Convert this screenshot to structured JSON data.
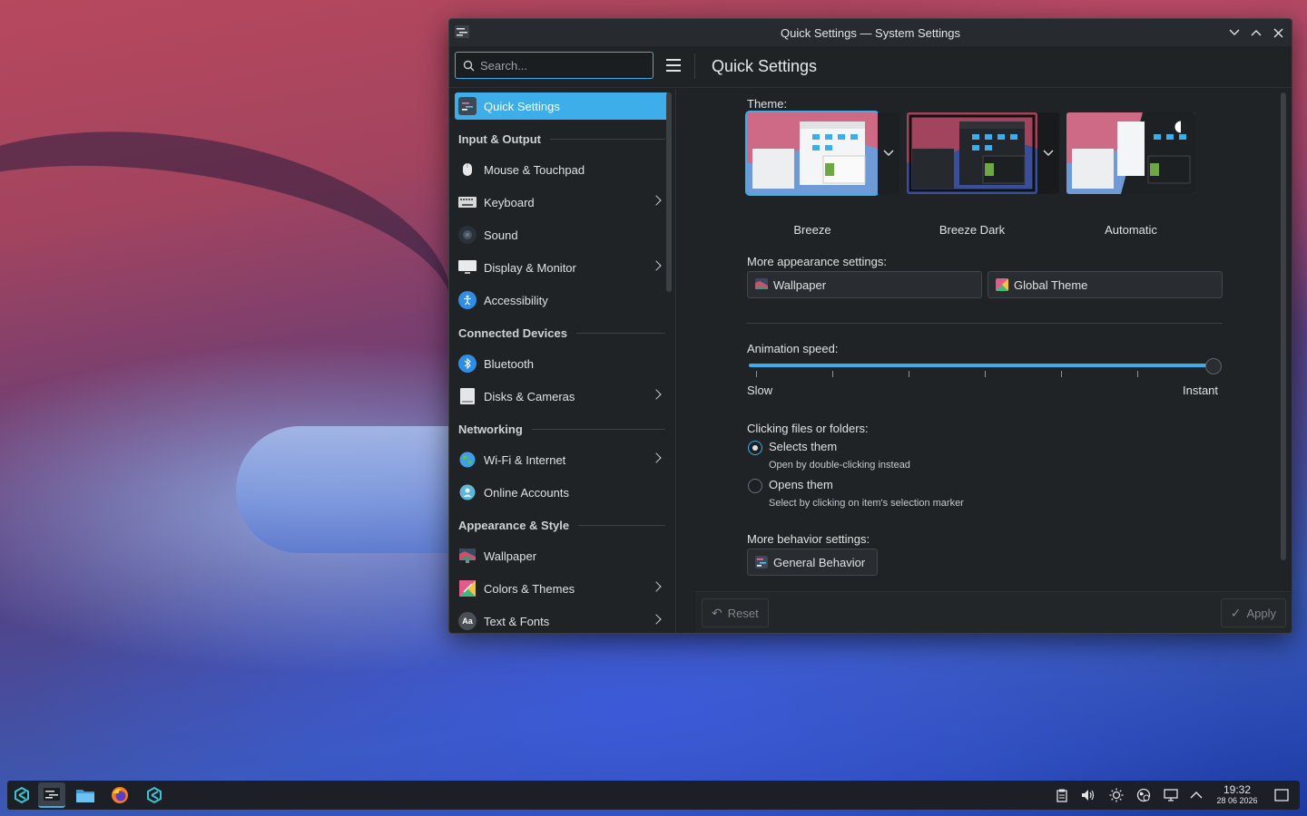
{
  "window": {
    "title": "Quick Settings — System Settings",
    "page_title": "Quick Settings"
  },
  "search": {
    "placeholder": "Search..."
  },
  "sidebar": {
    "items": [
      {
        "label": "Quick Settings",
        "icon": "quick-settings-icon",
        "active": true
      },
      {
        "label": "Mouse & Touchpad",
        "icon": "mouse-icon"
      },
      {
        "label": "Keyboard",
        "icon": "keyboard-icon",
        "has_children": true
      },
      {
        "label": "Sound",
        "icon": "speaker-icon"
      },
      {
        "label": "Display & Monitor",
        "icon": "monitor-icon",
        "has_children": true
      },
      {
        "label": "Accessibility",
        "icon": "accessibility-icon"
      },
      {
        "label": "Bluetooth",
        "icon": "bluetooth-icon"
      },
      {
        "label": "Disks & Cameras",
        "icon": "disk-icon",
        "has_children": true
      },
      {
        "label": "Wi-Fi & Internet",
        "icon": "globe-icon",
        "has_children": true
      },
      {
        "label": "Online Accounts",
        "icon": "online-accounts-icon"
      },
      {
        "label": "Wallpaper",
        "icon": "wallpaper-icon"
      },
      {
        "label": "Colors & Themes",
        "icon": "colors-icon",
        "has_children": true
      },
      {
        "label": "Text & Fonts",
        "icon": "fonts-icon",
        "has_children": true
      }
    ],
    "sections": [
      "Input & Output",
      "Connected Devices",
      "Networking",
      "Appearance & Style"
    ]
  },
  "content": {
    "theme_label": "Theme:",
    "themes": [
      {
        "name": "Breeze",
        "selected": true
      },
      {
        "name": "Breeze Dark"
      },
      {
        "name": "Automatic"
      }
    ],
    "more_appearance_label": "More appearance settings:",
    "wallpaper_btn": "Wallpaper",
    "global_theme_btn": "Global Theme",
    "animation_label": "Animation speed:",
    "slow": "Slow",
    "instant": "Instant",
    "animation_value": 1.0,
    "clicking_label": "Clicking files or folders:",
    "opt_select": "Selects them",
    "opt_select_hint": "Open by double-clicking instead",
    "opt_open": "Opens them",
    "opt_open_hint": "Select by clicking on item's selection marker",
    "more_behavior_label": "More behavior settings:",
    "general_behavior_btn": "General Behavior"
  },
  "footer": {
    "reset": "Reset",
    "apply": "Apply"
  },
  "taskbar": {
    "time": "19:32",
    "date": "28 06 2026"
  },
  "colors": {
    "accent": "#3daee9",
    "window_bg": "#202326"
  }
}
